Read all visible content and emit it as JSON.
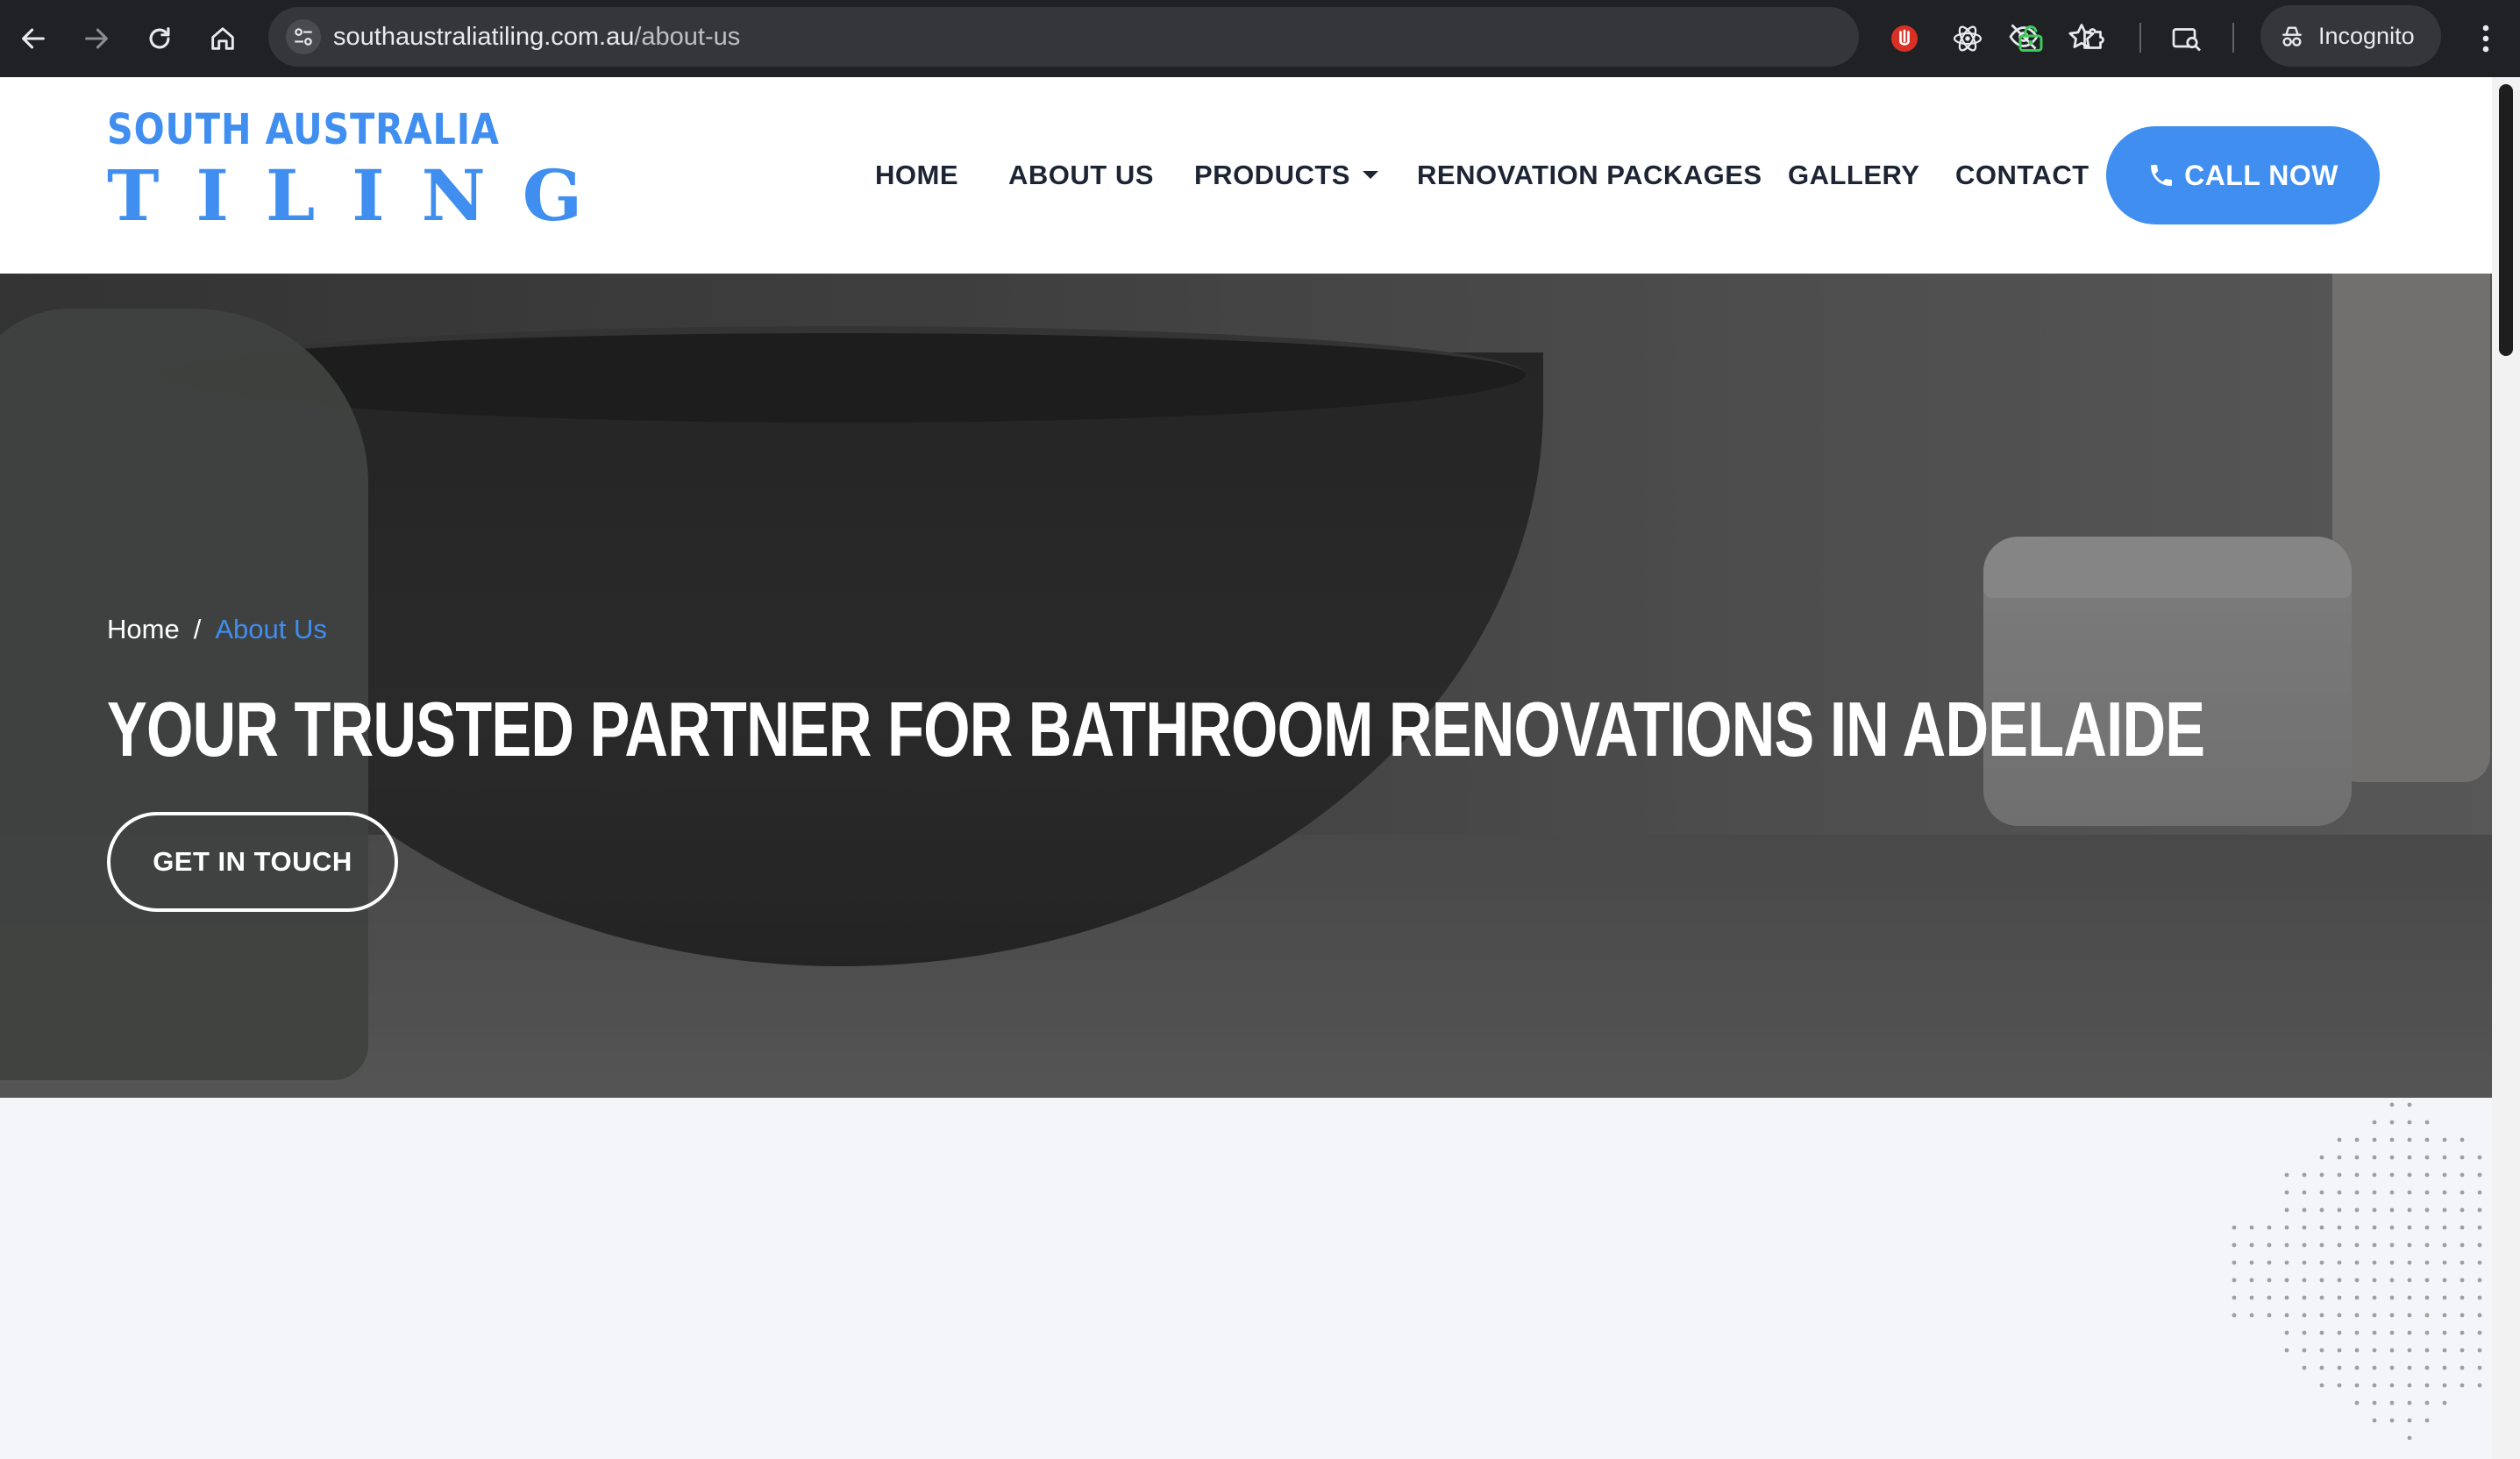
{
  "browser": {
    "url_domain": "southaustraliatiling.com.au",
    "url_path": "/about-us",
    "incognito_label": "Incognito",
    "icons": [
      "back-icon",
      "forward-icon",
      "reload-icon",
      "home-icon",
      "site-settings-icon",
      "eye-off-icon",
      "star-icon",
      "extension-red-icon",
      "react-icon",
      "lock-green-icon",
      "puzzle-icon",
      "tab-search-icon",
      "incognito-icon",
      "more-icon"
    ]
  },
  "site": {
    "logo_line1": "SOUTH AUSTRALIA",
    "logo_line2": "TILING",
    "brand_color": "#3f8ef0",
    "nav": {
      "home": "HOME",
      "about": "ABOUT US",
      "products": "PRODUCTS",
      "renovation": "RENOVATION PACKAGES",
      "gallery": "GALLERY",
      "contact": "CONTACT"
    },
    "call_now": "CALL NOW"
  },
  "hero": {
    "breadcrumb_home": "Home",
    "breadcrumb_sep": "/",
    "breadcrumb_current": "About Us",
    "title": "YOUR TRUSTED PARTNER FOR BATHROOM RENOVATIONS IN ADELAIDE",
    "cta": "GET IN TOUCH"
  }
}
